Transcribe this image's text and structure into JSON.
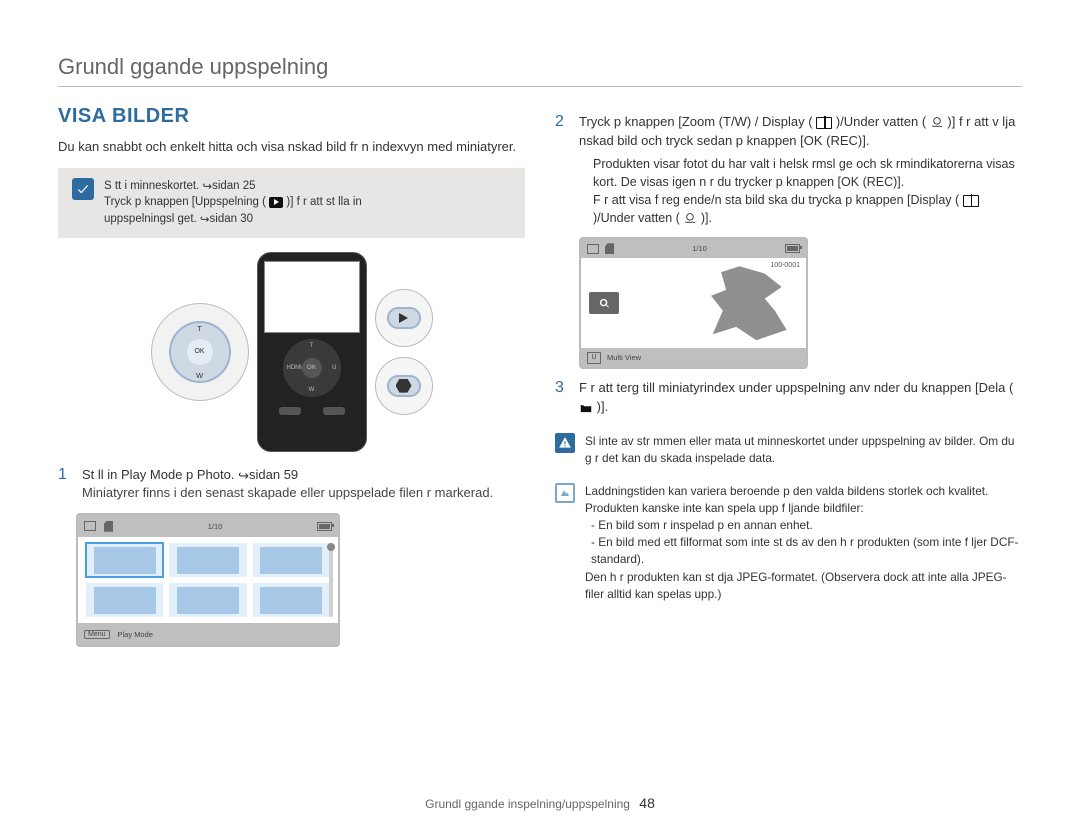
{
  "header": {
    "section_title": "Grundl ggande uppspelning"
  },
  "left": {
    "title": "VISA BILDER",
    "intro": "Du kan snabbt och enkelt hitta och visa  nskad bild fr n indexvyn med miniatyrer.",
    "tip_line1": "S tt i minneskortet. ",
    "tip_page1": "sidan 25",
    "tip_line2a": "Tryck p  knappen [Uppspelning (",
    "tip_line2b": ")] f r att st lla in",
    "tip_line3": "uppspelningsl get. ",
    "tip_page3": "sidan 30",
    "dpad_top": "T",
    "dpad_ok": "OK",
    "dpad_bottom": "W",
    "cam_ok": "OK",
    "cam_n": "T",
    "cam_s": "W",
    "cam_e": "U",
    "cam_w": "HDMI",
    "step1_num": "1",
    "step1a": "St ll in Play Mode p  Photo.  ",
    "step1_page": "sidan 59",
    "step1b": "Miniatyrer finns i den senast skapade eller uppspelade filen  r markerad.",
    "lcd_counter": "1/10",
    "lcd_mode": "Play Mode",
    "menu_label": "Menu"
  },
  "right": {
    "step2_num": "2",
    "step2a": "Tryck p  knappen [Zoom (T/W) / Display (",
    "step2b": ")/Under vatten (",
    "step2c": ")] f r att v lja  nskad bild och tryck sedan p  knappen [OK (REC)].",
    "step2_bul_a": "Produkten visar fotot du har valt i helsk rmsl ge och sk rmindikatorerna visas kort. De visas igen n r du trycker p  knappen [OK (REC)].",
    "step2_bul_b_a": "F r att visa f reg ende/n sta bild ska du trycka p  knappen [Display (",
    "step2_bul_b_b": ")/Under vatten (",
    "step2_bul_b_c": ")].",
    "lcd2_counter": "1/10",
    "lcd2_file": "100-0001",
    "lcd2_multi": "Multi View",
    "step3_num": "3",
    "step3a": "F r att  terg  till miniatyrindex under uppspelning anv nder du knappen [Dela (",
    "step3b": ")].",
    "warn": "Sl  inte av str mmen eller mata ut minneskortet under uppspelning av bilder. Om du g r det kan du skada inspelade data.",
    "info_a": "Laddningstiden kan variera beroende p  den valda bildens storlek och kvalitet.",
    "info_b": "Produkten kanske inte kan spela upp f ljande bildfiler:",
    "info_b1": "- En bild som  r inspelad p  en annan enhet.",
    "info_b2": "- En bild med ett filformat som inte st ds av den h r produkten (som inte f ljer DCF-standard).",
    "info_c": "Den h r produkten kan st dja JPEG-formatet. (Observera dock att inte alla JPEG-filer alltid kan spelas upp.)"
  },
  "footer": {
    "label": "Grundl ggande inspelning/uppspelning",
    "page": "48"
  }
}
